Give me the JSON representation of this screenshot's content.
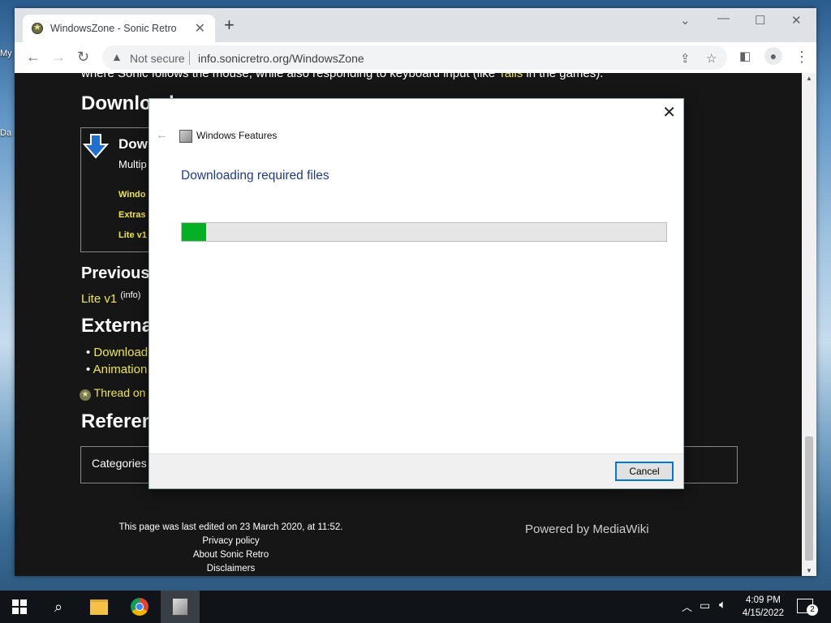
{
  "desktop": {
    "icon_label_1": "My",
    "icon_label_2": "Da"
  },
  "browser": {
    "tab_title": "WindowsZone - Sonic Retro",
    "new_tab": "+",
    "not_secure": "Not secure",
    "url": "info.sonicretro.org/WindowsZone"
  },
  "page": {
    "top_text": "where Sonic follows the mouse, while also responding to keyboard input (like ",
    "top_link": "Tails",
    "top_text_end": " in the games).",
    "download_heading": "Download",
    "box_title": "Dow",
    "box_sub": "Multip",
    "box_link1": "Windo",
    "box_link2": "Extras",
    "box_link3": "Lite v1",
    "previous_heading": "Previous",
    "lite_link": "Lite v1",
    "info_sup": "(info)",
    "external_heading": "Externa",
    "bullet1": "Download",
    "bullet2": "Animation",
    "thread_text": "Thread on",
    "references_heading": "Referen",
    "categories": "Categories",
    "footer_edited": "This page was last edited on 23 March 2020, at 11:52.",
    "footer_privacy": "Privacy policy",
    "footer_about": "About Sonic Retro",
    "footer_disclaimers": "Disclaimers",
    "powered_by": "Powered by MediaWiki"
  },
  "dialog": {
    "window_title": "Windows Features",
    "heading": "Downloading required files",
    "progress": 0.05,
    "cancel_label": "Cancel"
  },
  "taskbar": {
    "time": "4:09 PM",
    "date": "4/15/2022",
    "notifications": "2"
  }
}
